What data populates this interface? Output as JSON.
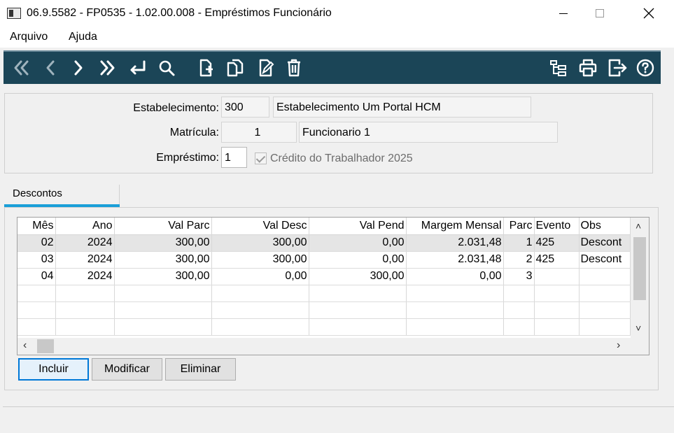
{
  "window": {
    "title": "06.9.5582 - FP0535 - 1.02.00.008 - Empréstimos Funcionário"
  },
  "menu": {
    "items": [
      "Arquivo",
      "Ajuda"
    ]
  },
  "toolbar": {
    "left_icons": [
      "first-icon",
      "previous-icon",
      "next-icon",
      "last-icon",
      "goto-icon",
      "search-icon",
      "new-icon",
      "copy-icon",
      "edit-icon",
      "delete-icon"
    ],
    "right_icons": [
      "tree-icon",
      "print-icon",
      "exit-icon",
      "help-icon"
    ],
    "color": "#1b4557"
  },
  "form": {
    "estabelecimento": {
      "label": "Estabelecimento:",
      "code": "300",
      "name": "Estabelecimento Um Portal HCM"
    },
    "matricula": {
      "label": "Matrícula:",
      "code": "1",
      "name": "Funcionario 1"
    },
    "emprestimo": {
      "label": "Empréstimo:",
      "code": "1",
      "checkbox_label": "Crédito do Trabalhador 2025",
      "checked": true
    }
  },
  "tabs": {
    "active": "Descontos",
    "accent": "#1a9fd8"
  },
  "grid": {
    "columns": [
      "Mês",
      "Ano",
      "Val Parc",
      "Val Desc",
      "Val Pend",
      "Margem Mensal",
      "Parc",
      "Evento",
      "Obs"
    ],
    "rows": [
      [
        "02",
        "2024",
        "300,00",
        "300,00",
        "0,00",
        "2.031,48",
        "1",
        "425",
        "Descont"
      ],
      [
        "03",
        "2024",
        "300,00",
        "300,00",
        "0,00",
        "2.031,48",
        "2",
        "425",
        "Descont"
      ],
      [
        "04",
        "2024",
        "300,00",
        "0,00",
        "300,00",
        "0,00",
        "3",
        "",
        ""
      ]
    ]
  },
  "buttons": {
    "incluir": "Incluir",
    "modificar": "Modificar",
    "eliminar": "Eliminar"
  }
}
